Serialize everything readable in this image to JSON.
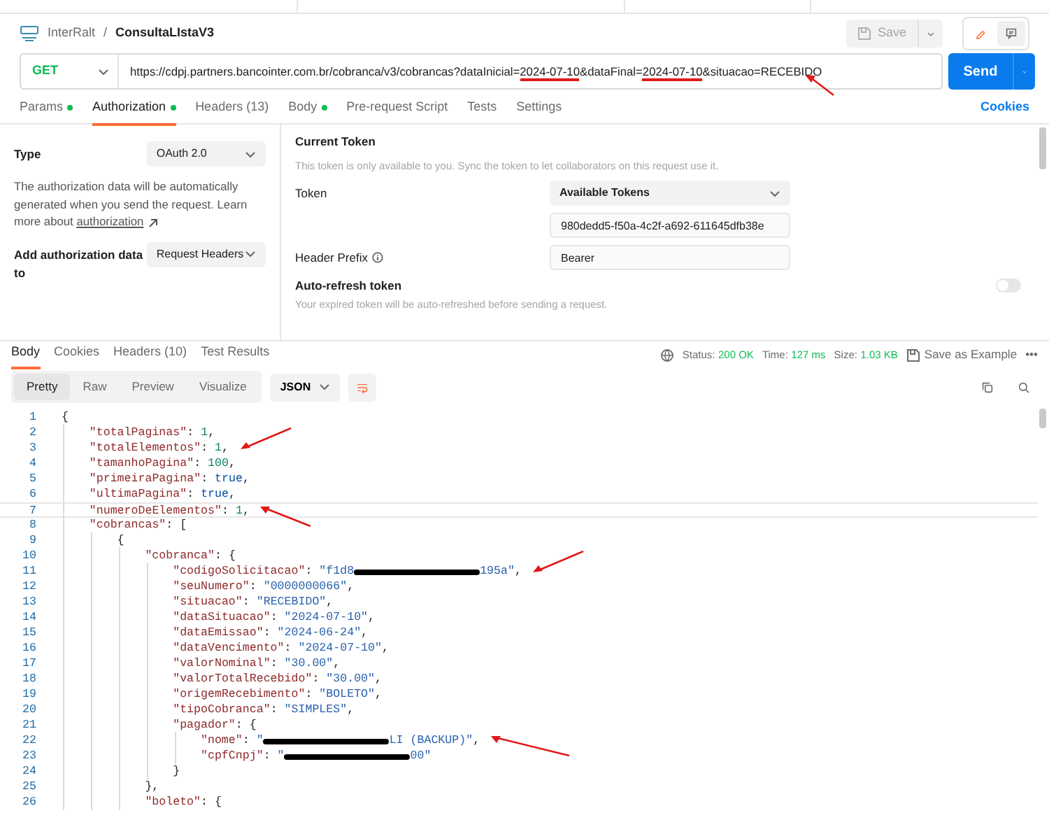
{
  "header": {
    "workspace": "InterRalt",
    "separator": "/",
    "request_name": "ConsultaLIstaV3",
    "save_label": "Save",
    "save_disabled": true,
    "edit_selected": true
  },
  "request": {
    "method": "GET",
    "send_label": "Send",
    "url_segments": [
      {
        "text": "https://cdpj.partners.bancointer.com.br/cobranca/v3/cobrancas?dataInicial=",
        "underlined": false
      },
      {
        "text": "2024-07-10",
        "underlined": true
      },
      {
        "text": "&dataFinal=",
        "underlined": false
      },
      {
        "text": "2024-07-10",
        "underlined": true
      },
      {
        "text": "&situacao=RECEBIDO",
        "underlined": false
      }
    ],
    "arrow": {
      "kind": "up"
    }
  },
  "request_tabs": [
    {
      "label": "Params",
      "dot": true,
      "selected": false
    },
    {
      "label": "Authorization",
      "dot": true,
      "selected": true
    },
    {
      "label": "Headers (13)",
      "dot": false,
      "selected": false
    },
    {
      "label": "Body",
      "dot": true,
      "selected": false
    },
    {
      "label": "Pre-request Script",
      "dot": false,
      "selected": false
    },
    {
      "label": "Tests",
      "dot": false,
      "selected": false
    },
    {
      "label": "Settings",
      "dot": false,
      "selected": false
    }
  ],
  "cookies_link": "Cookies",
  "auth": {
    "type_label": "Type",
    "type_value": "OAuth 2.0",
    "description": "The authorization data will be automatically generated when you send the request. Learn more about ",
    "learn_link": "authorization",
    "add_to_label": "Add authorization data to",
    "add_to_value": "Request Headers",
    "current_token_title": "Current Token",
    "current_token_note": "This token is only available to you. Sync the token to let collaborators on this request use it.",
    "token_label": "Token",
    "token_select": "Available Tokens",
    "token_value": "980dedd5-f50a-4c2f-a692-611645dfb38e",
    "header_prefix_label": "Header Prefix",
    "header_prefix_value": "Bearer",
    "auto_refresh_label": "Auto-refresh token",
    "auto_refresh_on": false,
    "auto_refresh_note": "Your expired token will be auto-refreshed before sending a request."
  },
  "response_tabs": [
    {
      "label": "Body",
      "selected": true
    },
    {
      "label": "Cookies",
      "selected": false
    },
    {
      "label": "Headers (10)",
      "selected": false
    },
    {
      "label": "Test Results",
      "selected": false
    }
  ],
  "status": {
    "status_label": "Status:",
    "status_value": "200 OK",
    "time_label": "Time:",
    "time_value": "127 ms",
    "size_label": "Size:",
    "size_value": "1.03 KB",
    "save_example": "Save as Example",
    "more": "•••"
  },
  "view_tabs": [
    {
      "label": "Pretty",
      "selected": true
    },
    {
      "label": "Raw",
      "selected": false
    },
    {
      "label": "Preview",
      "selected": false
    },
    {
      "label": "Visualize",
      "selected": false
    }
  ],
  "format": "JSON",
  "code_lines": [
    {
      "number": "1",
      "tokens": [
        {
          "kind": "punct",
          "text": "{"
        }
      ],
      "children": [
        {
          "number": "2",
          "tokens": [
            {
              "kind": "key",
              "text": "\"totalPaginas\""
            },
            {
              "kind": "punct",
              "text": ": "
            },
            {
              "kind": "num",
              "text": "1"
            },
            {
              "kind": "punct",
              "text": ","
            }
          ]
        },
        {
          "number": "3",
          "tokens": [
            {
              "kind": "key",
              "text": "\"totalElementos\""
            },
            {
              "kind": "punct",
              "text": ": "
            },
            {
              "kind": "num",
              "text": "1"
            },
            {
              "kind": "punct",
              "text": ","
            }
          ],
          "arrow": {
            "kind": "down"
          }
        },
        {
          "number": "4",
          "tokens": [
            {
              "kind": "key",
              "text": "\"tamanhoPagina\""
            },
            {
              "kind": "punct",
              "text": ": "
            },
            {
              "kind": "num",
              "text": "100"
            },
            {
              "kind": "punct",
              "text": ","
            }
          ]
        },
        {
          "number": "5",
          "tokens": [
            {
              "kind": "key",
              "text": "\"primeiraPagina\""
            },
            {
              "kind": "punct",
              "text": ": "
            },
            {
              "kind": "bool",
              "text": "true"
            },
            {
              "kind": "punct",
              "text": ","
            }
          ]
        },
        {
          "number": "6",
          "tokens": [
            {
              "kind": "key",
              "text": "\"ultimaPagina\""
            },
            {
              "kind": "punct",
              "text": ": "
            },
            {
              "kind": "bool",
              "text": "true"
            },
            {
              "kind": "punct",
              "text": ","
            }
          ]
        },
        {
          "number": "7",
          "tokens": [
            {
              "kind": "key",
              "text": "\"numeroDeElementos\""
            },
            {
              "kind": "punct",
              "text": ": "
            },
            {
              "kind": "num",
              "text": "1"
            },
            {
              "kind": "punct",
              "text": ","
            }
          ],
          "arrow": {
            "kind": "up"
          },
          "cursor": true
        },
        {
          "number": "8",
          "tokens": [
            {
              "kind": "key",
              "text": "\"cobrancas\""
            },
            {
              "kind": "punct",
              "text": ": ["
            }
          ],
          "children": [
            {
              "number": "9",
              "tokens": [
                {
                  "kind": "punct",
                  "text": "{"
                }
              ],
              "children": [
                {
                  "number": "10",
                  "tokens": [
                    {
                      "kind": "key",
                      "text": "\"cobranca\""
                    },
                    {
                      "kind": "punct",
                      "text": ": {"
                    }
                  ],
                  "children": [
                    {
                      "number": "11",
                      "tokens": [
                        {
                          "kind": "key",
                          "text": "\"codigoSolicitacao\""
                        },
                        {
                          "kind": "punct",
                          "text": ": "
                        },
                        {
                          "kind": "str",
                          "text": "\"f1d8"
                        },
                        {
                          "kind": "redacted"
                        },
                        {
                          "kind": "str",
                          "text": "195a\""
                        },
                        {
                          "kind": "punct",
                          "text": ","
                        }
                      ],
                      "arrow": {
                        "kind": "down"
                      }
                    },
                    {
                      "number": "12",
                      "tokens": [
                        {
                          "kind": "key",
                          "text": "\"seuNumero\""
                        },
                        {
                          "kind": "punct",
                          "text": ": "
                        },
                        {
                          "kind": "str",
                          "text": "\"0000000066\""
                        },
                        {
                          "kind": "punct",
                          "text": ","
                        }
                      ]
                    },
                    {
                      "number": "13",
                      "tokens": [
                        {
                          "kind": "key",
                          "text": "\"situacao\""
                        },
                        {
                          "kind": "punct",
                          "text": ": "
                        },
                        {
                          "kind": "str",
                          "text": "\"RECEBIDO\""
                        },
                        {
                          "kind": "punct",
                          "text": ","
                        }
                      ]
                    },
                    {
                      "number": "14",
                      "tokens": [
                        {
                          "kind": "key",
                          "text": "\"dataSituacao\""
                        },
                        {
                          "kind": "punct",
                          "text": ": "
                        },
                        {
                          "kind": "str",
                          "text": "\"2024-07-10\""
                        },
                        {
                          "kind": "punct",
                          "text": ","
                        }
                      ]
                    },
                    {
                      "number": "15",
                      "tokens": [
                        {
                          "kind": "key",
                          "text": "\"dataEmissao\""
                        },
                        {
                          "kind": "punct",
                          "text": ": "
                        },
                        {
                          "kind": "str",
                          "text": "\"2024-06-24\""
                        },
                        {
                          "kind": "punct",
                          "text": ","
                        }
                      ]
                    },
                    {
                      "number": "16",
                      "tokens": [
                        {
                          "kind": "key",
                          "text": "\"dataVencimento\""
                        },
                        {
                          "kind": "punct",
                          "text": ": "
                        },
                        {
                          "kind": "str",
                          "text": "\"2024-07-10\""
                        },
                        {
                          "kind": "punct",
                          "text": ","
                        }
                      ]
                    },
                    {
                      "number": "17",
                      "tokens": [
                        {
                          "kind": "key",
                          "text": "\"valorNominal\""
                        },
                        {
                          "kind": "punct",
                          "text": ": "
                        },
                        {
                          "kind": "str",
                          "text": "\"30.00\""
                        },
                        {
                          "kind": "punct",
                          "text": ","
                        }
                      ]
                    },
                    {
                      "number": "18",
                      "tokens": [
                        {
                          "kind": "key",
                          "text": "\"valorTotalRecebido\""
                        },
                        {
                          "kind": "punct",
                          "text": ": "
                        },
                        {
                          "kind": "str",
                          "text": "\"30.00\""
                        },
                        {
                          "kind": "punct",
                          "text": ","
                        }
                      ]
                    },
                    {
                      "number": "19",
                      "tokens": [
                        {
                          "kind": "key",
                          "text": "\"origemRecebimento\""
                        },
                        {
                          "kind": "punct",
                          "text": ": "
                        },
                        {
                          "kind": "str",
                          "text": "\"BOLETO\""
                        },
                        {
                          "kind": "punct",
                          "text": ","
                        }
                      ]
                    },
                    {
                      "number": "20",
                      "tokens": [
                        {
                          "kind": "key",
                          "text": "\"tipoCobranca\""
                        },
                        {
                          "kind": "punct",
                          "text": ": "
                        },
                        {
                          "kind": "str",
                          "text": "\"SIMPLES\""
                        },
                        {
                          "kind": "punct",
                          "text": ","
                        }
                      ]
                    },
                    {
                      "number": "21",
                      "tokens": [
                        {
                          "kind": "key",
                          "text": "\"pagador\""
                        },
                        {
                          "kind": "punct",
                          "text": ": {"
                        }
                      ],
                      "children": [
                        {
                          "number": "22",
                          "tokens": [
                            {
                              "kind": "key",
                              "text": "\"nome\""
                            },
                            {
                              "kind": "punct",
                              "text": ": "
                            },
                            {
                              "kind": "str",
                              "text": "\""
                            },
                            {
                              "kind": "redacted"
                            },
                            {
                              "kind": "str",
                              "text": "LI (BACKUP)\""
                            },
                            {
                              "kind": "punct",
                              "text": ","
                            }
                          ],
                          "arrow": {
                            "kind": "up"
                          }
                        },
                        {
                          "number": "23",
                          "tokens": [
                            {
                              "kind": "key",
                              "text": "\"cpfCnpj\""
                            },
                            {
                              "kind": "punct",
                              "text": ": "
                            },
                            {
                              "kind": "str",
                              "text": "\""
                            },
                            {
                              "kind": "redacted"
                            },
                            {
                              "kind": "str",
                              "text": "00\""
                            }
                          ]
                        }
                      ]
                    },
                    {
                      "number": "24",
                      "tokens": [
                        {
                          "kind": "punct",
                          "text": "}"
                        }
                      ]
                    }
                  ]
                },
                {
                  "number": "25",
                  "tokens": [
                    {
                      "kind": "punct",
                      "text": "},"
                    }
                  ]
                },
                {
                  "number": "26",
                  "tokens": [
                    {
                      "kind": "key",
                      "text": "\"boleto\""
                    },
                    {
                      "kind": "punct",
                      "text": ": {"
                    }
                  ]
                }
              ]
            }
          ]
        }
      ]
    }
  ]
}
